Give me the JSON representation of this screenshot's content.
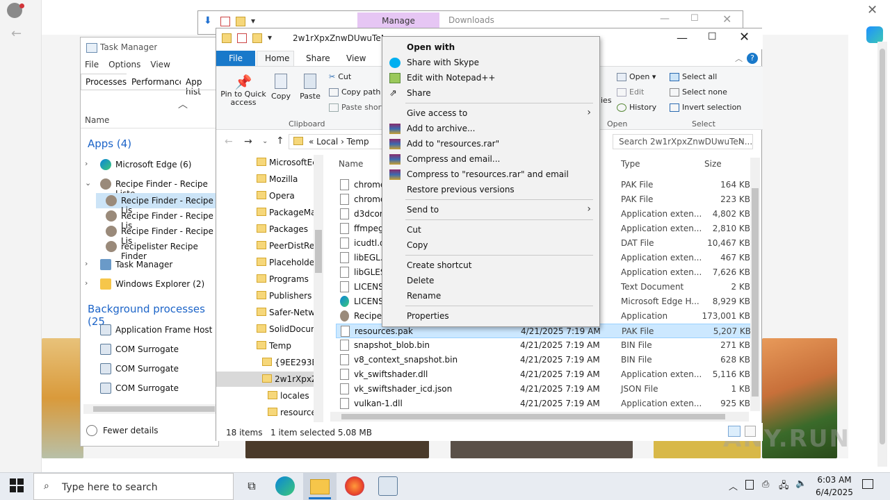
{
  "taskmanager": {
    "title": "Task Manager",
    "menu": [
      "File",
      "Options",
      "View"
    ],
    "tabs": [
      "Processes",
      "Performance",
      "App hist"
    ],
    "column_name": "Name",
    "apps_header": "Apps (4)",
    "apps": [
      {
        "label": "Microsoft Edge (6)",
        "expand": "›"
      },
      {
        "label": "Recipe Finder - Recipe Liste",
        "expand": "⌄"
      },
      {
        "label": "Recipe Finder - Recipe Lis"
      },
      {
        "label": "Recipe Finder - Recipe Lis"
      },
      {
        "label": "Recipe Finder - Recipe Lis"
      },
      {
        "label": "recipelister Recipe Finder"
      },
      {
        "label": "Task Manager",
        "expand": "›"
      },
      {
        "label": "Windows Explorer (2)",
        "expand": "›"
      }
    ],
    "bg_header": "Background processes (25",
    "bg": [
      "Application Frame Host",
      "COM Surrogate",
      "COM Surrogate",
      "COM Surrogate"
    ],
    "fewer": "Fewer details"
  },
  "explorer_back": {
    "manage": "Manage",
    "title": "Downloads"
  },
  "explorer": {
    "title": "2w1rXpxZnwDUwuTeNvo",
    "tabs": {
      "file": "File",
      "home": "Home",
      "share": "Share",
      "view": "View"
    },
    "ribbon": {
      "pin": "Pin to Quick access",
      "copy": "Copy",
      "paste": "Paste",
      "cut": "Cut",
      "copy_path": "Copy path",
      "paste_shortcut": "Paste shortc",
      "clipboard": "Clipboard",
      "ties": "ies",
      "open": "Open",
      "edit": "Edit",
      "history": "History",
      "open_group": "Open",
      "select_all": "Select all",
      "select_none": "Select none",
      "invert": "Invert selection",
      "select_group": "Select"
    },
    "address": "«  Local  ›  Temp",
    "search": "Search 2w1rXpxZnwDUwuTeN...",
    "nav": [
      "MicrosoftEc",
      "Mozilla",
      "Opera",
      "PackageMa",
      "Packages",
      "PeerDistRep",
      "Placeholder",
      "Programs",
      "Publishers",
      "Safer-Netwo",
      "SolidDocum",
      "Temp",
      "{9EE293E3-",
      "2w1rXpxZr",
      "locales",
      "resource"
    ],
    "columns": {
      "name": "Name",
      "type": "Type",
      "size": "Size"
    },
    "files": [
      {
        "name": "chrome",
        "date": "",
        "type": "PAK File",
        "size": "164 KB"
      },
      {
        "name": "chrome",
        "date": "",
        "type": "PAK File",
        "size": "223 KB"
      },
      {
        "name": "d3dcom",
        "date": "",
        "type": "Application exten...",
        "size": "4,802 KB"
      },
      {
        "name": "ffmpeg.",
        "date": "",
        "type": "Application exten...",
        "size": "2,810 KB"
      },
      {
        "name": "icudtl.d",
        "date": "",
        "type": "DAT File",
        "size": "10,467 KB"
      },
      {
        "name": "libEGL.c",
        "date": "",
        "type": "Application exten...",
        "size": "467 KB"
      },
      {
        "name": "libGLES",
        "date": "",
        "type": "Application exten...",
        "size": "7,626 KB"
      },
      {
        "name": "LICENSE",
        "date": "",
        "type": "Text Document",
        "size": "2 KB"
      },
      {
        "name": "LICENSE",
        "date": "",
        "type": "Microsoft Edge H...",
        "size": "8,929 KB"
      },
      {
        "name": "Recipe F",
        "date": "",
        "type": "Application",
        "size": "173,001 KB"
      },
      {
        "name": "resources.pak",
        "date": "4/21/2025 7:19 AM",
        "type": "PAK File",
        "size": "5,207 KB"
      },
      {
        "name": "snapshot_blob.bin",
        "date": "4/21/2025 7:19 AM",
        "type": "BIN File",
        "size": "271 KB"
      },
      {
        "name": "v8_context_snapshot.bin",
        "date": "4/21/2025 7:19 AM",
        "type": "BIN File",
        "size": "628 KB"
      },
      {
        "name": "vk_swiftshader.dll",
        "date": "4/21/2025 7:19 AM",
        "type": "Application exten...",
        "size": "5,116 KB"
      },
      {
        "name": "vk_swiftshader_icd.json",
        "date": "4/21/2025 7:19 AM",
        "type": "JSON File",
        "size": "1 KB"
      },
      {
        "name": "vulkan-1.dll",
        "date": "4/21/2025 7:19 AM",
        "type": "Application exten...",
        "size": "925 KB"
      }
    ],
    "status_items": "18 items",
    "status_selected": "1 item selected  5.08 MB"
  },
  "context_menu": [
    {
      "label": "Open with",
      "bold": true
    },
    {
      "label": "Share with Skype"
    },
    {
      "label": "Edit with Notepad++"
    },
    {
      "label": "Share"
    },
    {
      "label": "Give access to",
      "submenu": true
    },
    {
      "label": "Add to archive..."
    },
    {
      "label": "Add to \"resources.rar\""
    },
    {
      "label": "Compress and email..."
    },
    {
      "label": "Compress to \"resources.rar\" and email"
    },
    {
      "label": "Restore previous versions"
    },
    {
      "label": "Send to",
      "submenu": true
    },
    {
      "label": "Cut"
    },
    {
      "label": "Copy"
    },
    {
      "label": "Create shortcut"
    },
    {
      "label": "Delete"
    },
    {
      "label": "Rename"
    },
    {
      "label": "Properties"
    }
  ],
  "taskbar": {
    "search_placeholder": "Type here to search",
    "time": "6:03 AM",
    "date": "6/4/2025"
  },
  "watermark": "ANY.RUN",
  "colors": {
    "accent": "#1979ca",
    "selection": "#cce8ff",
    "manage": "#e6c6f4"
  }
}
